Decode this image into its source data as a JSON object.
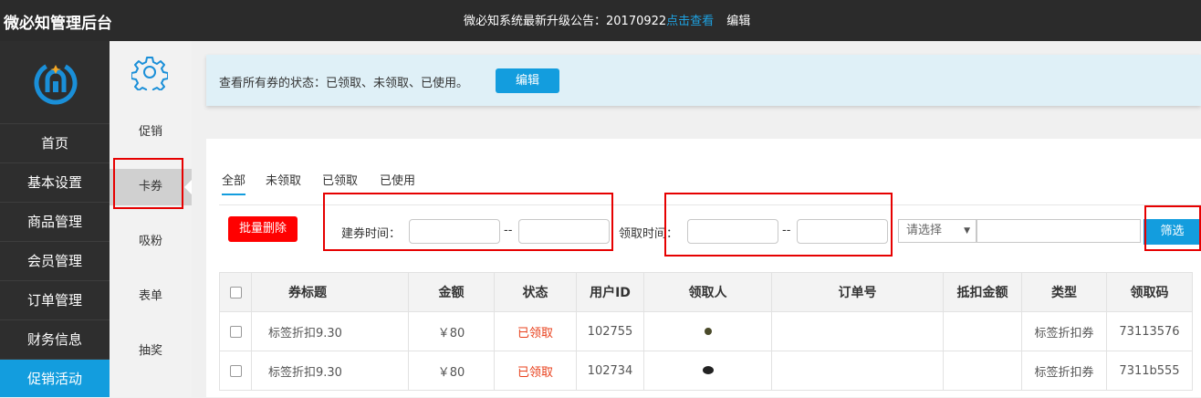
{
  "header": {
    "brand": "微必知管理后台",
    "notice_text": "微必知系统最新升级公告：20170922",
    "notice_link": "点击查看",
    "edit_label": "编辑"
  },
  "sidebar": {
    "items": [
      {
        "label": "首页"
      },
      {
        "label": "基本设置"
      },
      {
        "label": "商品管理"
      },
      {
        "label": "会员管理"
      },
      {
        "label": "订单管理"
      },
      {
        "label": "财务信息"
      },
      {
        "label": "促销活动"
      }
    ],
    "active": "促销活动"
  },
  "subnav": {
    "items": [
      {
        "label": "促销"
      },
      {
        "label": "卡券"
      },
      {
        "label": "吸粉"
      },
      {
        "label": "表单"
      },
      {
        "label": "抽奖"
      }
    ],
    "active": "卡券"
  },
  "banner": {
    "text": "查看所有券的状态：已领取、未领取、已使用。",
    "button": "编辑"
  },
  "tabs": [
    {
      "label": "全部"
    },
    {
      "label": "未领取"
    },
    {
      "label": "已领取"
    },
    {
      "label": "已使用"
    }
  ],
  "filters": {
    "batch_delete": "批量删除",
    "create_time_label": "建券时间：",
    "claim_time_label": "领取时间：",
    "range_sep": "--",
    "select_placeholder": "请选择",
    "filter_button": "筛选"
  },
  "table": {
    "headers": [
      "券标题",
      "金额",
      "状态",
      "用户ID",
      "领取人",
      "订单号",
      "抵扣金额",
      "类型",
      "领取码"
    ],
    "rows": [
      [
        "标签折扣9.30",
        "￥80",
        "已领取",
        "102755",
        "",
        "",
        "",
        "标签折扣券",
        "73113576"
      ],
      [
        "标签折扣9.30",
        "￥80",
        "已领取",
        "102734",
        "",
        "",
        "",
        "标签折扣券",
        "7311b555"
      ]
    ]
  },
  "colors": {
    "accent": "#139dde",
    "danger": "#ff0000",
    "status_text": "#e8401c",
    "topbar": "#2b2b2b",
    "sidebar": "#2e2e2e"
  }
}
